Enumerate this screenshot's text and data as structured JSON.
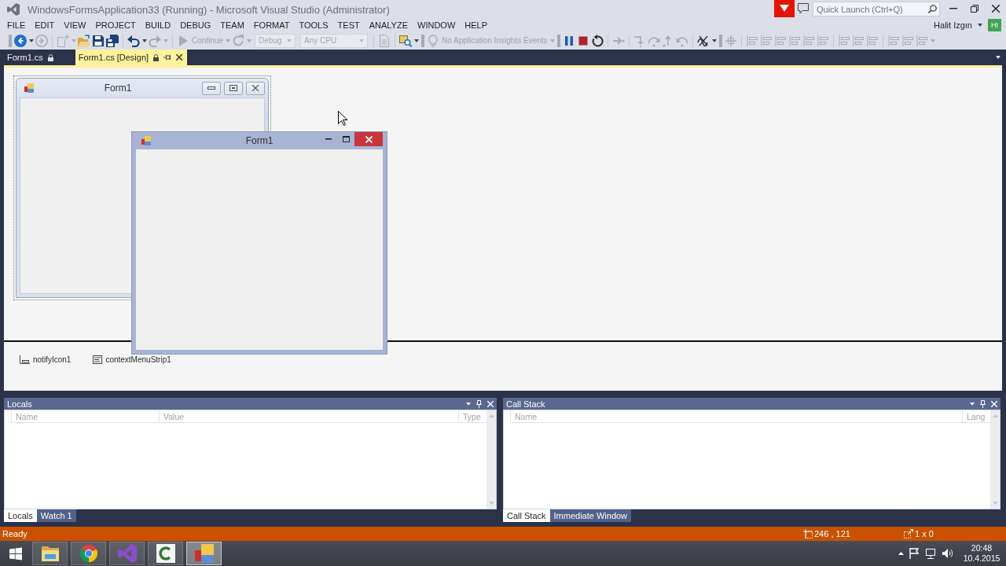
{
  "window": {
    "title": "WindowsFormsApplication33 (Running) - Microsoft Visual Studio (Administrator)"
  },
  "quick_launch": {
    "placeholder": "Quick Launch (Ctrl+Q)"
  },
  "menu": [
    "FILE",
    "EDIT",
    "VIEW",
    "PROJECT",
    "BUILD",
    "DEBUG",
    "TEAM",
    "FORMAT",
    "TOOLS",
    "TEST",
    "ANALYZE",
    "WINDOW",
    "HELP"
  ],
  "account": {
    "name": "Halit Izgın",
    "initials": "HI"
  },
  "toolbar": [
    {
      "kind": "grip"
    },
    {
      "kind": "back",
      "disabled": false,
      "menu": true
    },
    {
      "kind": "forward",
      "disabled": true,
      "menu": false
    },
    {
      "kind": "separator"
    },
    {
      "kind": "new_project",
      "disabled": true,
      "menu": true
    },
    {
      "kind": "open",
      "disabled": false,
      "menu": false
    },
    {
      "kind": "save",
      "disabled": false,
      "menu": false
    },
    {
      "kind": "save_all",
      "disabled": false,
      "menu": false
    },
    {
      "kind": "separator"
    },
    {
      "kind": "undo",
      "disabled": false,
      "menu": true
    },
    {
      "kind": "redo",
      "disabled": true,
      "menu": true
    },
    {
      "kind": "separator"
    },
    {
      "kind": "continue",
      "label": "Continue",
      "disabled": true,
      "menu": true
    },
    {
      "kind": "refresh",
      "disabled": true,
      "menu": true
    },
    {
      "kind": "combo",
      "value": "Debug",
      "disabled": true
    },
    {
      "kind": "combo",
      "value": "Any CPU",
      "disabled": true
    },
    {
      "kind": "separator"
    },
    {
      "kind": "document",
      "disabled": true,
      "menu": false
    },
    {
      "kind": "separator"
    },
    {
      "kind": "find",
      "disabled": false,
      "menu": true
    },
    {
      "kind": "grip"
    },
    {
      "kind": "insights",
      "label": "No Application Insights Events",
      "disabled": true,
      "menu": true
    },
    {
      "kind": "grip"
    },
    {
      "kind": "pause",
      "disabled": false,
      "menu": false
    },
    {
      "kind": "stop",
      "disabled": false,
      "menu": false
    },
    {
      "kind": "restart",
      "disabled": false,
      "menu": false
    },
    {
      "kind": "separator"
    },
    {
      "kind": "show_next",
      "disabled": true,
      "menu": false
    },
    {
      "kind": "separator"
    },
    {
      "kind": "step_into",
      "disabled": true,
      "menu": false
    },
    {
      "kind": "step_over",
      "disabled": true,
      "menu": false
    },
    {
      "kind": "step_out",
      "disabled": true,
      "menu": false
    },
    {
      "kind": "step_back",
      "disabled": true,
      "menu": false
    },
    {
      "kind": "separator"
    },
    {
      "kind": "exceptions",
      "disabled": false,
      "menu": true
    },
    {
      "kind": "grip"
    },
    {
      "kind": "guides",
      "disabled": true,
      "menu": false
    },
    {
      "kind": "separator"
    },
    {
      "kind": "align",
      "disabled": true,
      "menu": false
    },
    {
      "kind": "align",
      "disabled": true,
      "menu": false
    },
    {
      "kind": "align",
      "disabled": true,
      "menu": false
    },
    {
      "kind": "align",
      "disabled": true,
      "menu": false
    },
    {
      "kind": "align",
      "disabled": true,
      "menu": false
    },
    {
      "kind": "align",
      "disabled": true,
      "menu": false
    },
    {
      "kind": "separator"
    },
    {
      "kind": "align",
      "disabled": true,
      "menu": false
    },
    {
      "kind": "align",
      "disabled": true,
      "menu": false
    },
    {
      "kind": "align",
      "disabled": true,
      "menu": false
    },
    {
      "kind": "separator"
    },
    {
      "kind": "align",
      "disabled": true,
      "menu": false
    },
    {
      "kind": "align",
      "disabled": true,
      "menu": false
    },
    {
      "kind": "align",
      "disabled": true,
      "menu": true
    }
  ],
  "document_tabs": [
    {
      "label": "Form1.cs",
      "selected": false
    },
    {
      "label": "Form1.cs [Design]",
      "selected": true
    }
  ],
  "designer": {
    "form": {
      "title": "Form1"
    },
    "running_form": {
      "title": "Form1"
    },
    "components": [
      {
        "kind": "notify_icon",
        "name": "notifyIcon1"
      },
      {
        "kind": "context_menu",
        "name": "contextMenuStrip1"
      }
    ]
  },
  "tool_windows": [
    {
      "title": "Locals",
      "columns": [
        "Name",
        "Value",
        "Type"
      ],
      "tabs": [
        {
          "label": "Locals",
          "selected": true
        },
        {
          "label": "Watch 1",
          "selected": false
        }
      ]
    },
    {
      "title": "Call Stack",
      "columns": [
        "Name",
        "Lang"
      ],
      "tabs": [
        {
          "label": "Call Stack",
          "selected": true
        },
        {
          "label": "Immediate Window",
          "selected": false
        }
      ]
    }
  ],
  "status_bar": {
    "message": "Ready",
    "position": "246 , 121",
    "size": "1 x 0"
  },
  "taskbar": {
    "apps": [
      {
        "kind": "file_explorer",
        "selected": false
      },
      {
        "kind": "browser",
        "selected": false
      },
      {
        "kind": "ide",
        "selected": false
      },
      {
        "kind": "recorder",
        "selected": false
      },
      {
        "kind": "application",
        "selected": true
      }
    ],
    "clock": {
      "time": "20:48",
      "date": "10.4.2015"
    }
  }
}
